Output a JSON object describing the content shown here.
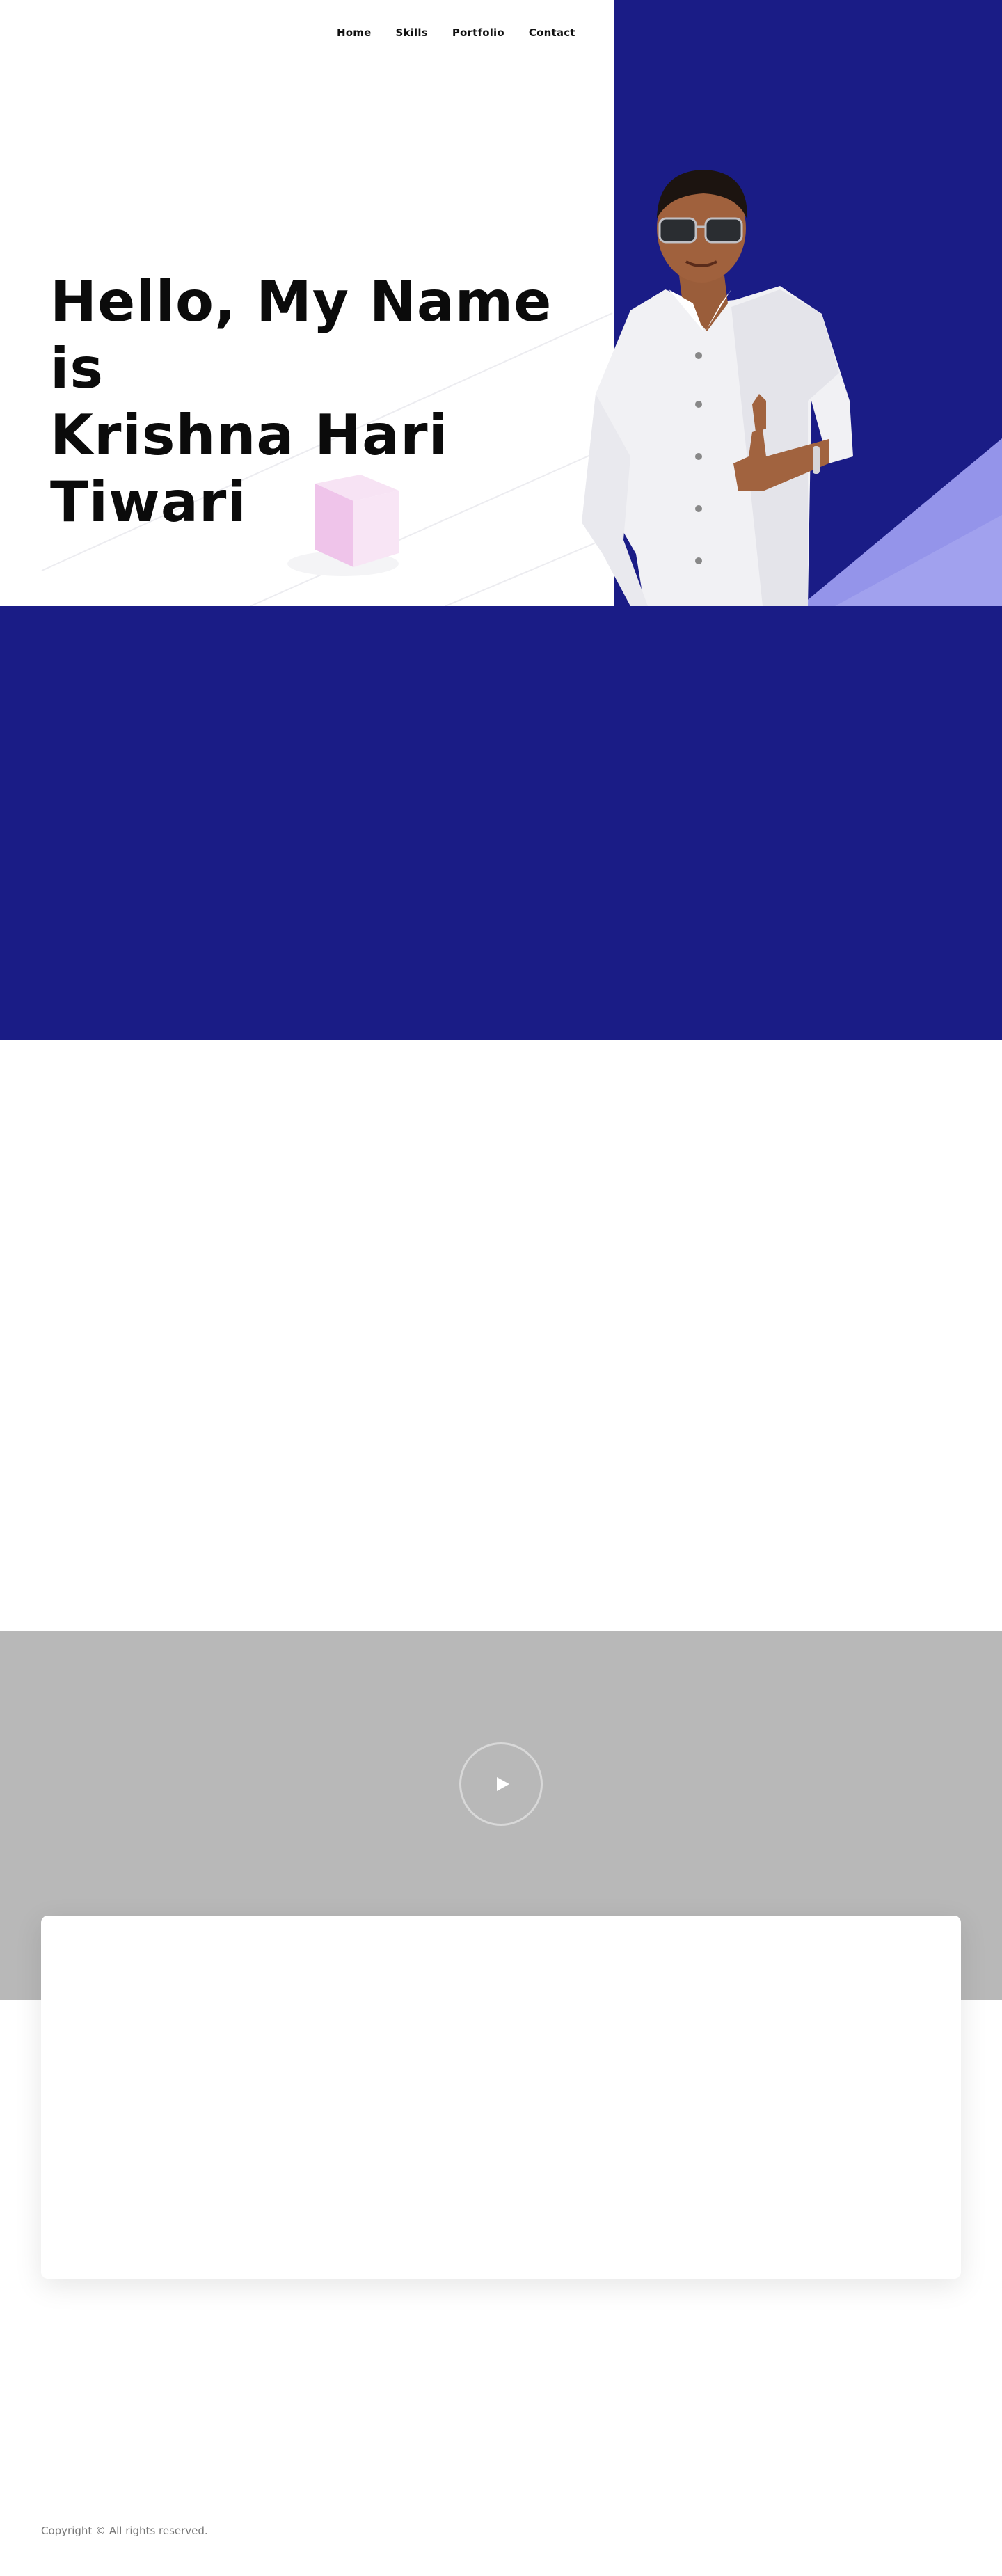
{
  "nav": {
    "items": [
      {
        "label": "Home"
      },
      {
        "label": "Skills"
      },
      {
        "label": "Portfolio"
      },
      {
        "label": "Contact"
      }
    ]
  },
  "hero": {
    "title_line1": "Hello, My Name is",
    "title_line2": "Krishna Hari",
    "title_line3": "Tiwari",
    "image_alt": "Photo of Krishna Hari Tiwari giving a thumbs up",
    "accent_color": "#1a1c86"
  },
  "video": {
    "play_icon": "play-icon"
  },
  "footer": {
    "copyright": "Copyright © All rights reserved."
  },
  "colors": {
    "primary_blue": "#1a1c86",
    "video_gray": "#b8b8b8",
    "light_violet": "#8e8ee8"
  }
}
